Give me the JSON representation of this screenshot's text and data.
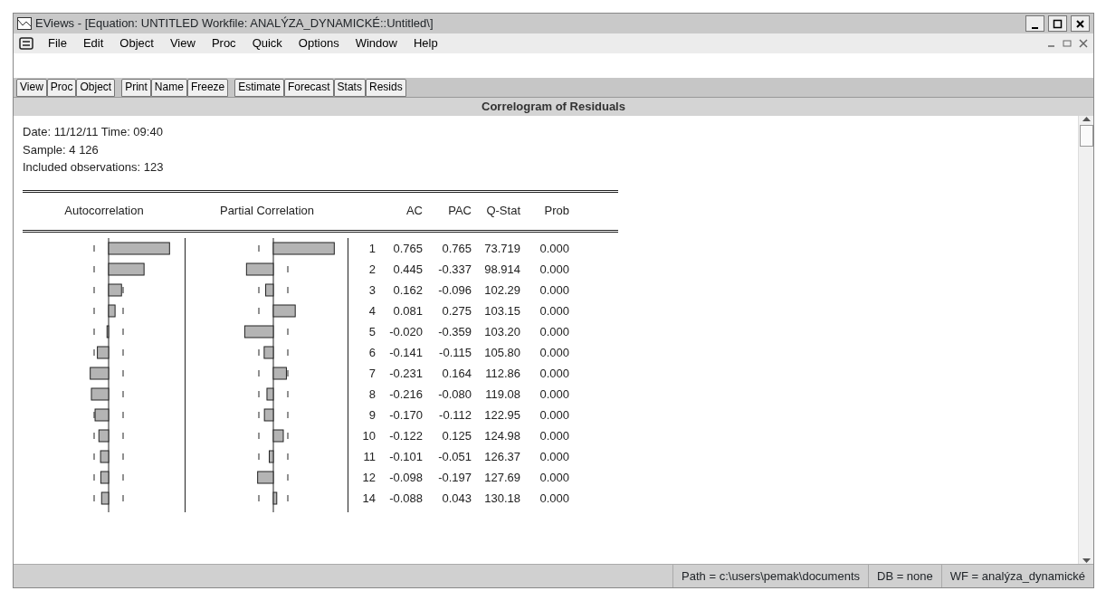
{
  "window": {
    "title": "EViews - [Equation: UNTITLED   Workfile: ANALÝZA_DYNAMICKÉ::Untitled\\]"
  },
  "menu": [
    "File",
    "Edit",
    "Object",
    "View",
    "Proc",
    "Quick",
    "Options",
    "Window",
    "Help"
  ],
  "toolbar": [
    [
      "View",
      "Proc",
      "Object"
    ],
    [
      "Print",
      "Name",
      "Freeze"
    ],
    [
      "Estimate",
      "Forecast",
      "Stats",
      "Resids"
    ]
  ],
  "view_title": "Correlogram of Residuals",
  "info": [
    "Date: 11/12/11   Time: 09:40",
    "Sample: 4 126",
    "Included observations: 123"
  ],
  "columns": [
    "Autocorrelation",
    "Partial Correlation",
    "AC",
    "PAC",
    "Q-Stat",
    "Prob"
  ],
  "rows": [
    {
      "lag": "1",
      "ac": "0.765",
      "pac": "0.765",
      "q": "73.719",
      "prob": "0.000"
    },
    {
      "lag": "2",
      "ac": "0.445",
      "pac": "-0.337",
      "q": "98.914",
      "prob": "0.000"
    },
    {
      "lag": "3",
      "ac": "0.162",
      "pac": "-0.096",
      "q": "102.29",
      "prob": "0.000"
    },
    {
      "lag": "4",
      "ac": "0.081",
      "pac": "0.275",
      "q": "103.15",
      "prob": "0.000"
    },
    {
      "lag": "5",
      "ac": "-0.020",
      "pac": "-0.359",
      "q": "103.20",
      "prob": "0.000"
    },
    {
      "lag": "6",
      "ac": "-0.141",
      "pac": "-0.115",
      "q": "105.80",
      "prob": "0.000"
    },
    {
      "lag": "7",
      "ac": "-0.231",
      "pac": "0.164",
      "q": "112.86",
      "prob": "0.000"
    },
    {
      "lag": "8",
      "ac": "-0.216",
      "pac": "-0.080",
      "q": "119.08",
      "prob": "0.000"
    },
    {
      "lag": "9",
      "ac": "-0.170",
      "pac": "-0.112",
      "q": "122.95",
      "prob": "0.000"
    },
    {
      "lag": "10",
      "ac": "-0.122",
      "pac": "0.125",
      "q": "124.98",
      "prob": "0.000"
    },
    {
      "lag": "11",
      "ac": "-0.101",
      "pac": "-0.051",
      "q": "126.37",
      "prob": "0.000"
    },
    {
      "lag": "12",
      "ac": "-0.098",
      "pac": "-0.197",
      "q": "127.69",
      "prob": "0.000"
    },
    {
      "lag": "14",
      "ac": "-0.088",
      "pac": "0.043",
      "q": "130.18",
      "prob": "0.000"
    }
  ],
  "status_bar": [
    "Path = c:\\users\\pemak\\documents",
    "DB = none",
    "WF = analýza_dynamické"
  ]
}
